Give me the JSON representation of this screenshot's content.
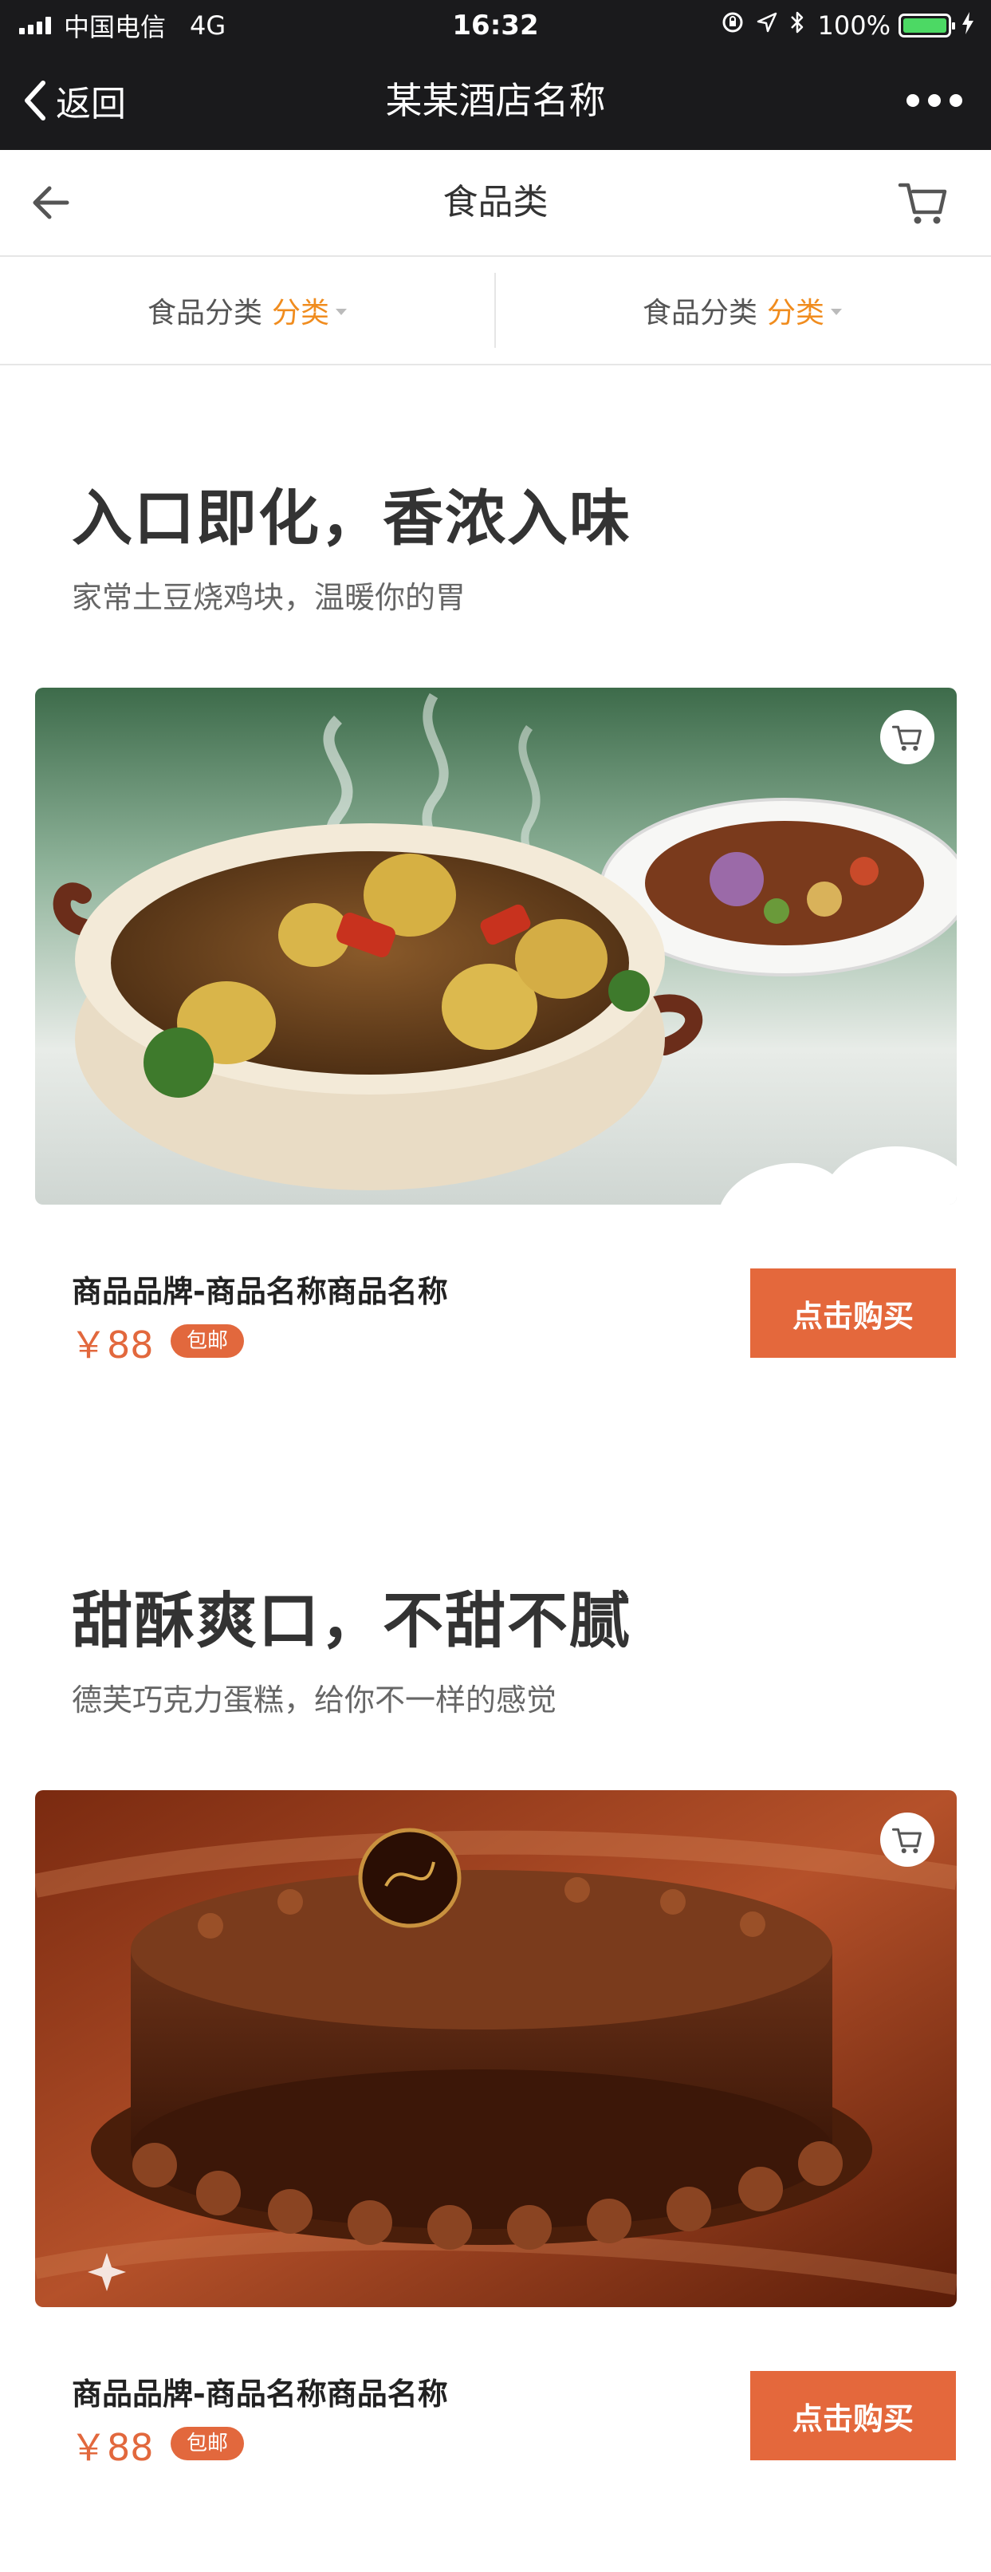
{
  "status_bar": {
    "carrier": "中国电信",
    "network": "4G",
    "time": "16:32",
    "battery_percent": "100%",
    "battery_level": 1.0
  },
  "nav": {
    "back_label": "返回",
    "title": "某某酒店名称",
    "more_icon": "more-dots-icon"
  },
  "subheader": {
    "title": "食品类",
    "back_icon": "arrow-left-icon",
    "cart_icon": "cart-icon"
  },
  "filters": [
    {
      "label": "食品分类",
      "accent": "分类"
    },
    {
      "label": "食品分类",
      "accent": "分类"
    }
  ],
  "products": [
    {
      "headline": "入口即化，香浓入味",
      "description": "家常土豆烧鸡块，温暖你的胃",
      "image": "braised-chicken-potato-clay-pot",
      "name": "商品品牌-商品名称商品名称",
      "price": "￥88",
      "badge": "包邮",
      "buy_label": "点击购买"
    },
    {
      "headline": "甜酥爽口，不甜不腻",
      "description": "德芙巧克力蛋糕，给你不一样的感觉",
      "image": "chocolate-cake",
      "name": "商品品牌-商品名称商品名称",
      "price": "￥88",
      "badge": "包邮",
      "buy_label": "点击购买"
    }
  ],
  "colors": {
    "topbar": "#1a1a1c",
    "accent_orange": "#f08c1e",
    "price_red": "#e2683d",
    "buy_button": "#e4683c",
    "battery_green": "#4cd964"
  }
}
